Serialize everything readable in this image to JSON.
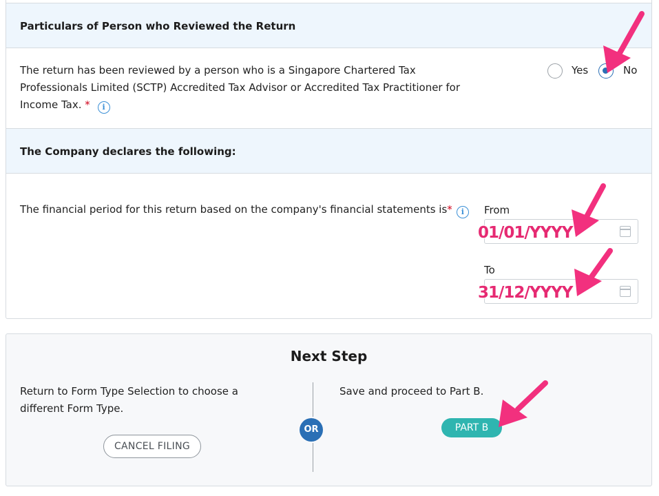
{
  "review_section": {
    "header": "Particulars of Person who Reviewed the Return",
    "question_line1": "The return has been reviewed by a person who is a Singapore Chartered Tax",
    "question_line2": "Professionals Limited (SCTP) Accredited Tax Advisor or Accredited Tax Practitioner for",
    "question_line3": "Income Tax.",
    "required_mark": "*",
    "yes_label": "Yes",
    "no_label": "No",
    "selected": "No"
  },
  "declaration_section": {
    "header": "The Company declares the following:",
    "question": "The financial period for this return based on the company's financial statements is",
    "required_mark": "*",
    "from_label": "From",
    "from_value": "01/01/YYYY",
    "to_label": "To",
    "to_value": "31/12/YYYY"
  },
  "next_step": {
    "title": "Next Step",
    "left_line1": "Return to Form Type Selection to choose a",
    "left_line2": "different Form Type.",
    "cancel_button": "CANCEL FILING",
    "or_label": "OR",
    "right_text": "Save and proceed to Part B.",
    "partb_button": "PART B"
  },
  "colors": {
    "accent_blue": "#2a6fb5",
    "teal_button": "#2fb5b0",
    "header_bg": "#eef6fd",
    "annotation_pink": "#e62a72"
  },
  "icons": [
    "info-icon",
    "calendar-icon",
    "annotation-arrow"
  ]
}
